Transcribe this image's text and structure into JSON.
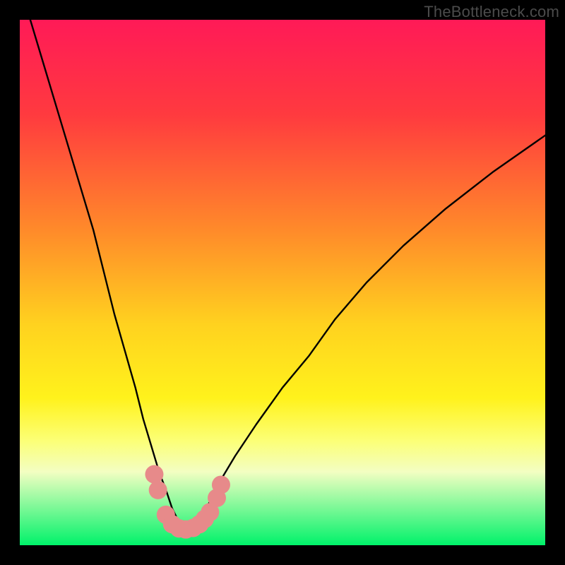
{
  "watermark": "TheBottleneck.com",
  "colors": {
    "frame": "#000000",
    "curve": "#000000",
    "marker_fill": "#e78a8a",
    "marker_stroke": "#d06a6a",
    "green_band_top": "#f3fec2",
    "green_band_bottom": "#00f26a"
  },
  "chart_data": {
    "type": "line",
    "title": "",
    "xlabel": "",
    "ylabel": "",
    "xlim": [
      0,
      100
    ],
    "ylim": [
      0,
      100
    ],
    "gradient_stops": [
      {
        "offset": 0,
        "color": "#ff1a57"
      },
      {
        "offset": 18,
        "color": "#ff3a3f"
      },
      {
        "offset": 40,
        "color": "#ff8a2a"
      },
      {
        "offset": 58,
        "color": "#ffd21f"
      },
      {
        "offset": 72,
        "color": "#fff21c"
      },
      {
        "offset": 80,
        "color": "#fcff75"
      },
      {
        "offset": 86,
        "color": "#f3fec2"
      },
      {
        "offset": 100,
        "color": "#00f26a"
      }
    ],
    "series": [
      {
        "name": "bottleneck-curve",
        "x": [
          2,
          5,
          8,
          11,
          14,
          16,
          18,
          20,
          22,
          23.5,
          25,
          26.5,
          28,
          29,
          30,
          31,
          32,
          33,
          34,
          36,
          38,
          41,
          45,
          50,
          55,
          60,
          66,
          73,
          81,
          90,
          100
        ],
        "y": [
          100,
          90,
          80,
          70,
          60,
          52,
          44,
          37,
          30,
          24,
          19,
          14,
          10,
          7,
          5,
          3.5,
          3,
          3.5,
          5,
          8,
          12,
          17,
          23,
          30,
          36,
          43,
          50,
          57,
          64,
          71,
          78
        ]
      }
    ],
    "markers": {
      "name": "highlighted-points",
      "points": [
        {
          "x": 25.6,
          "y": 13.5
        },
        {
          "x": 26.3,
          "y": 10.5
        },
        {
          "x": 27.8,
          "y": 5.8
        },
        {
          "x": 29.0,
          "y": 4.0
        },
        {
          "x": 30.3,
          "y": 3.2
        },
        {
          "x": 31.6,
          "y": 3.0
        },
        {
          "x": 33.0,
          "y": 3.3
        },
        {
          "x": 34.2,
          "y": 4.0
        },
        {
          "x": 35.2,
          "y": 5.0
        },
        {
          "x": 36.2,
          "y": 6.3
        },
        {
          "x": 37.5,
          "y": 9.0
        },
        {
          "x": 38.3,
          "y": 11.5
        }
      ]
    }
  }
}
